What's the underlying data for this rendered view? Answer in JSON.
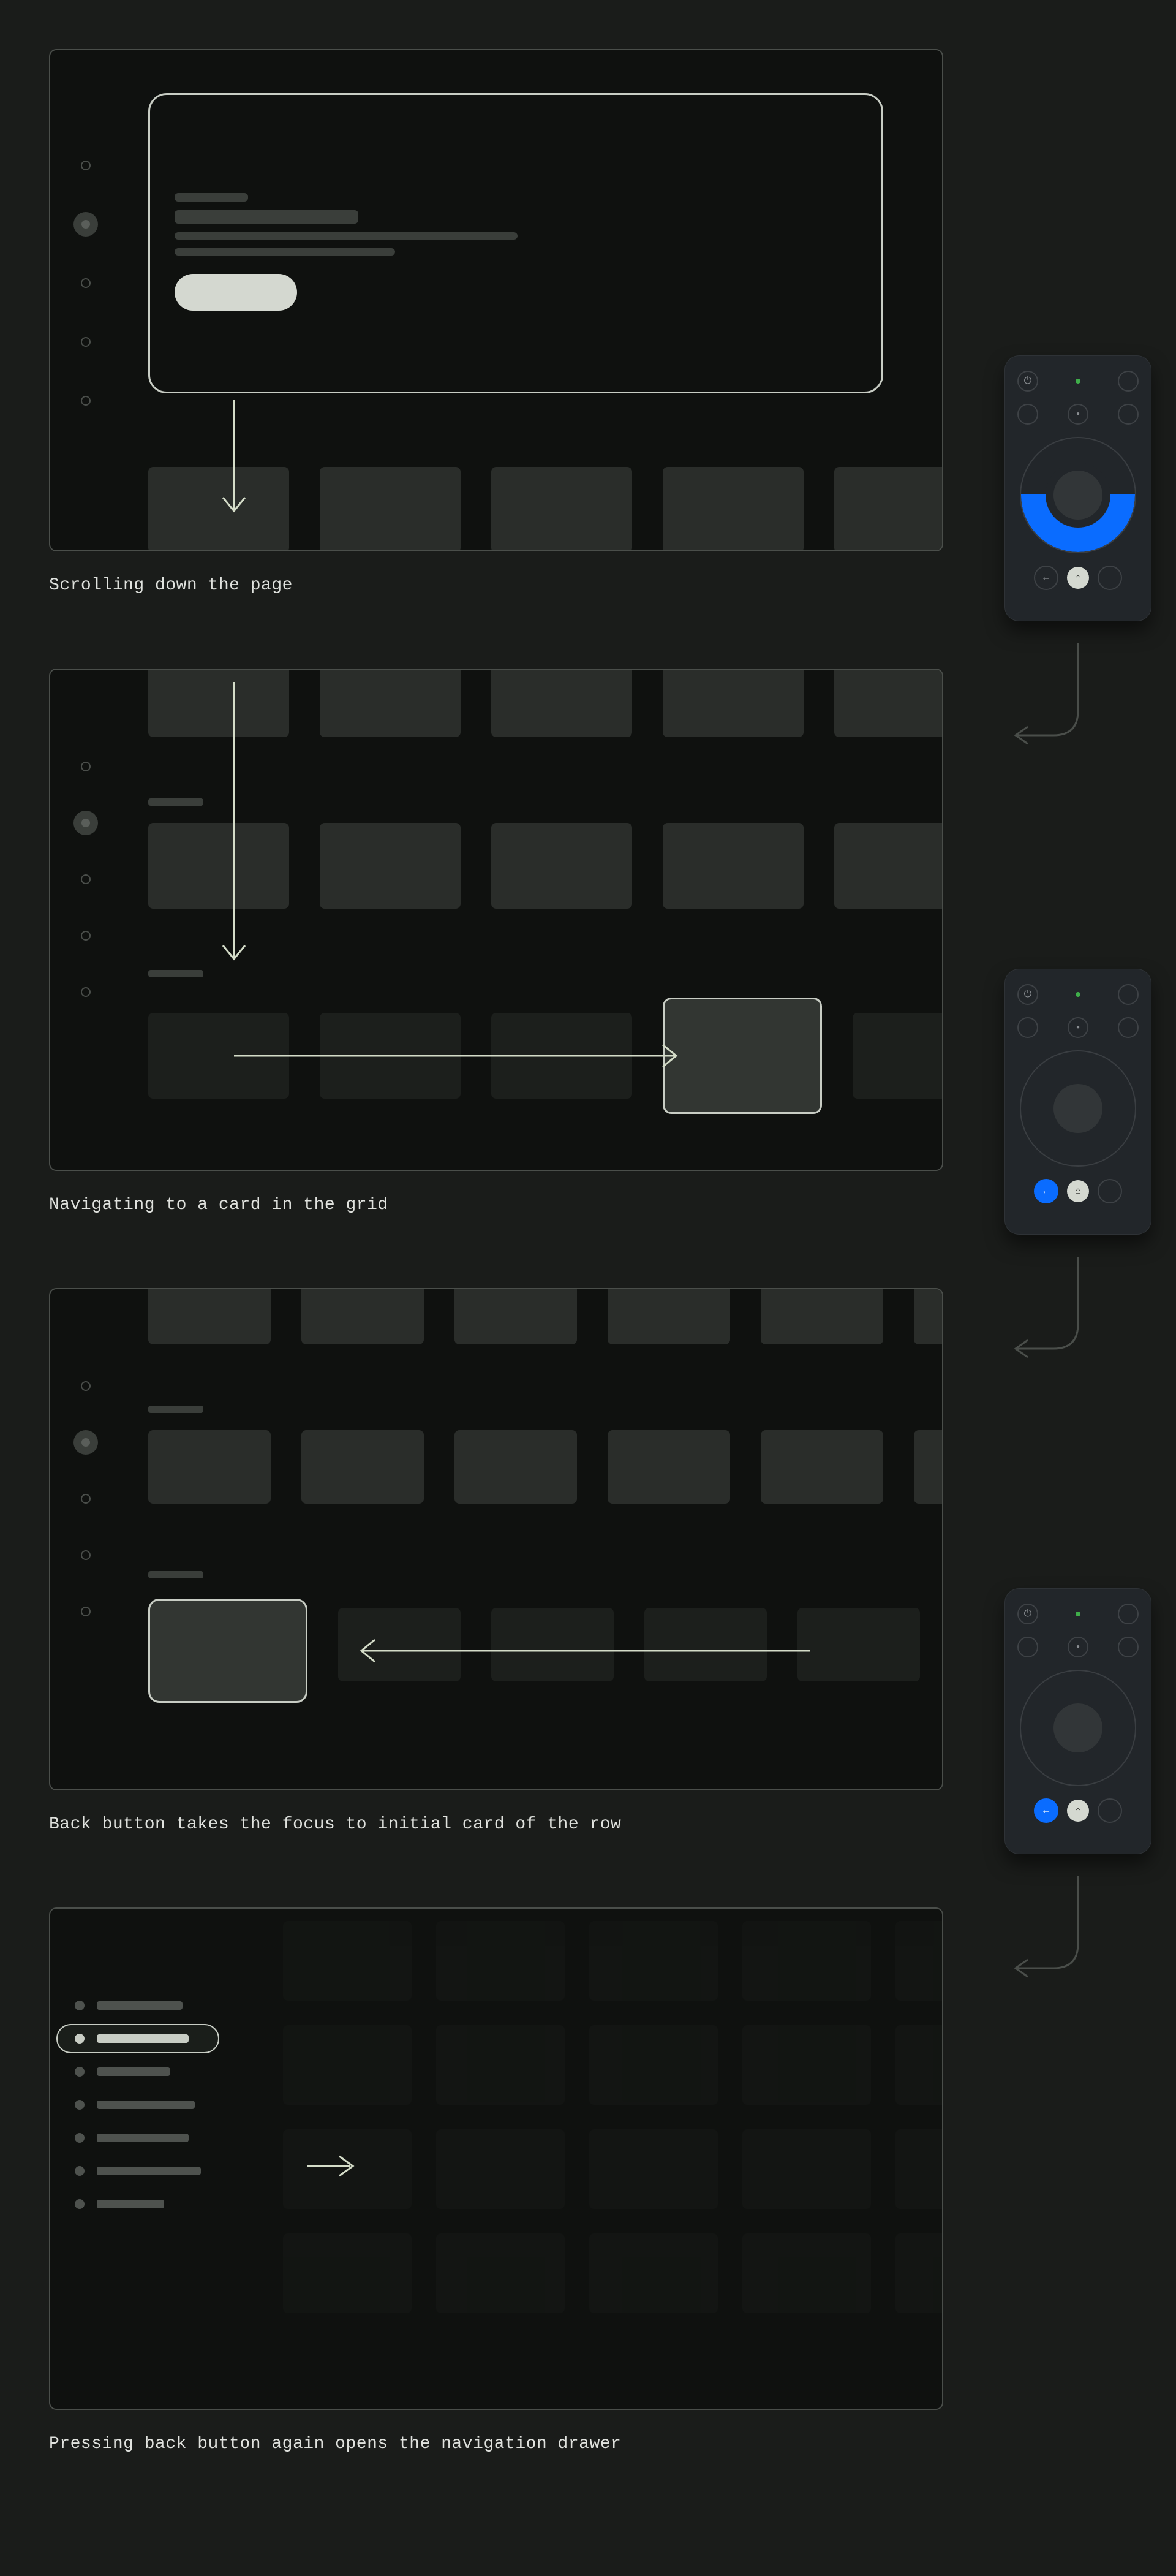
{
  "panels": [
    {
      "caption": "Scrolling down the page"
    },
    {
      "caption": "Navigating to a card in the grid"
    },
    {
      "caption": "Back button takes the focus to initial card of the row"
    },
    {
      "caption": "Pressing back button again opens the navigation drawer"
    }
  ],
  "remote": {
    "power_glyph": "⏻",
    "mic_glyph": "●",
    "back_glyph": "←",
    "home_glyph": "⌂",
    "highlight_color": "#0a6cff"
  },
  "nav_items_collapsed": 5,
  "nav_active_index": 1,
  "drawer_items": 7,
  "drawer_active_index": 1
}
